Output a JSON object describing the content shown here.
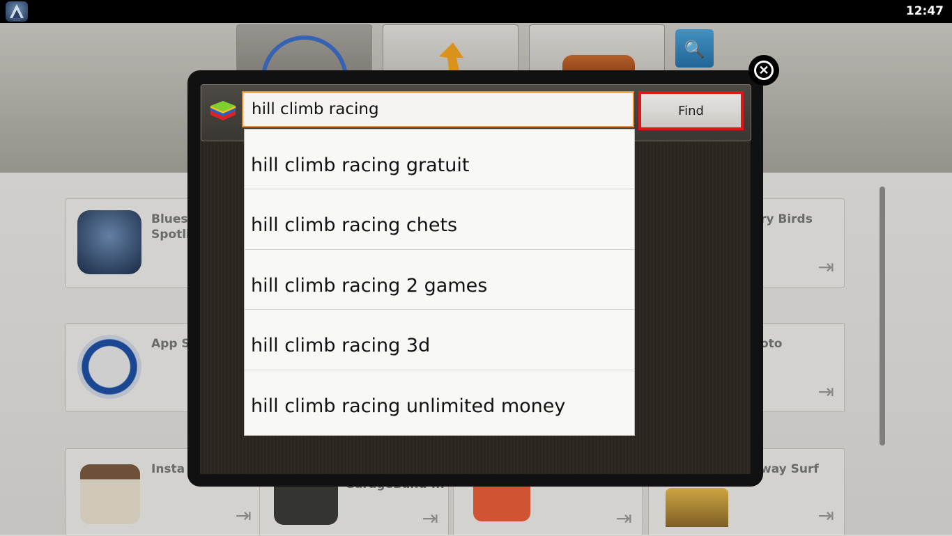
{
  "status_bar": {
    "time": "12:47"
  },
  "background": {
    "apps": [
      {
        "name": "Blues\nSpotli"
      },
      {
        "name": "ry Birds"
      },
      {
        "name": "App S"
      },
      {
        "name": "oto"
      },
      {
        "name": "Insta"
      },
      {
        "name": "way Surf"
      },
      {
        "name": "GarageBand ..."
      }
    ],
    "search_glyph": "🔍"
  },
  "dialog": {
    "search_query": "hill climb racing",
    "find_label": "Find",
    "close_glyph": "✕",
    "suggestions": [
      "hill climb racing gratuit",
      "hill climb racing chets",
      "hill climb racing 2 games",
      "hill climb racing 3d",
      "hill climb racing unlimited money"
    ]
  },
  "colors": {
    "input_border": "#f08a1c",
    "find_border": "#e01515",
    "dialog_bg": "#2b2520"
  }
}
